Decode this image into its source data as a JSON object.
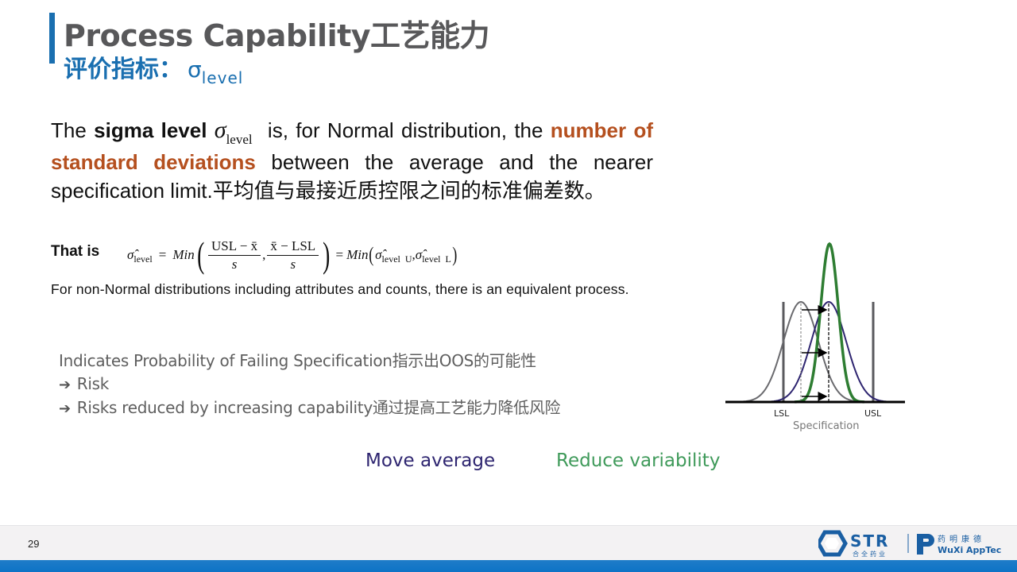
{
  "header": {
    "title": "Process Capability工艺能力",
    "subtitle_prefix": "评价指标：",
    "subtitle_symbol": "σ",
    "subtitle_sub": "level",
    "accent_color": "#1a6fb0"
  },
  "definition": {
    "part1": "The ",
    "bold1": "sigma level",
    "symbol": "σ",
    "symbol_sub": "level",
    "part2": " is, for Normal distribution, the ",
    "highlight": "number of standard deviations",
    "part3": " between the average and the nearer specification limit.平均值与最接近质控限之间的标准偏差数。",
    "highlight_color": "#b5501f"
  },
  "formula": {
    "label": "That is",
    "lhs": "σ̂",
    "lhs_sub": "level",
    "eq": "=",
    "min": "Min",
    "frac1_num": "USL − x̄",
    "frac1_den": "s",
    "frac2_num": "x̄ − LSL",
    "frac2_den": "s",
    "rhs_min": "Min",
    "rhs_term1": "σ̂",
    "rhs_term1_sub": "level  U",
    "rhs_term2": "σ̂",
    "rhs_term2_sub": "level  L"
  },
  "nonnormal_text": "For non-Normal distributions including attributes and counts, there is an equivalent process.",
  "bullets": {
    "line1": "Indicates Probability of Failing Specification指示出OOS的可能性",
    "arrow_icon": "➔",
    "line2": "Risk",
    "line3": "Risks reduced by increasing capability通过提高工艺能力降低风险"
  },
  "diagram": {
    "lsl_label": "LSL",
    "usl_label": "USL",
    "axis_label": "Specification",
    "curves": [
      {
        "name": "original",
        "color": "#6a6a6e"
      },
      {
        "name": "moved-average",
        "color": "#2e2570"
      },
      {
        "name": "reduced-variability",
        "color": "#2e7d32"
      }
    ]
  },
  "captions": {
    "move_average": "Move average",
    "reduce_variability": "Reduce variability"
  },
  "footer": {
    "page_number": "29",
    "logo1_text": "STR",
    "logo1_sub": "合全药业",
    "logo2_cn": "药明康德",
    "logo2_en": "WuXi AppTec"
  }
}
